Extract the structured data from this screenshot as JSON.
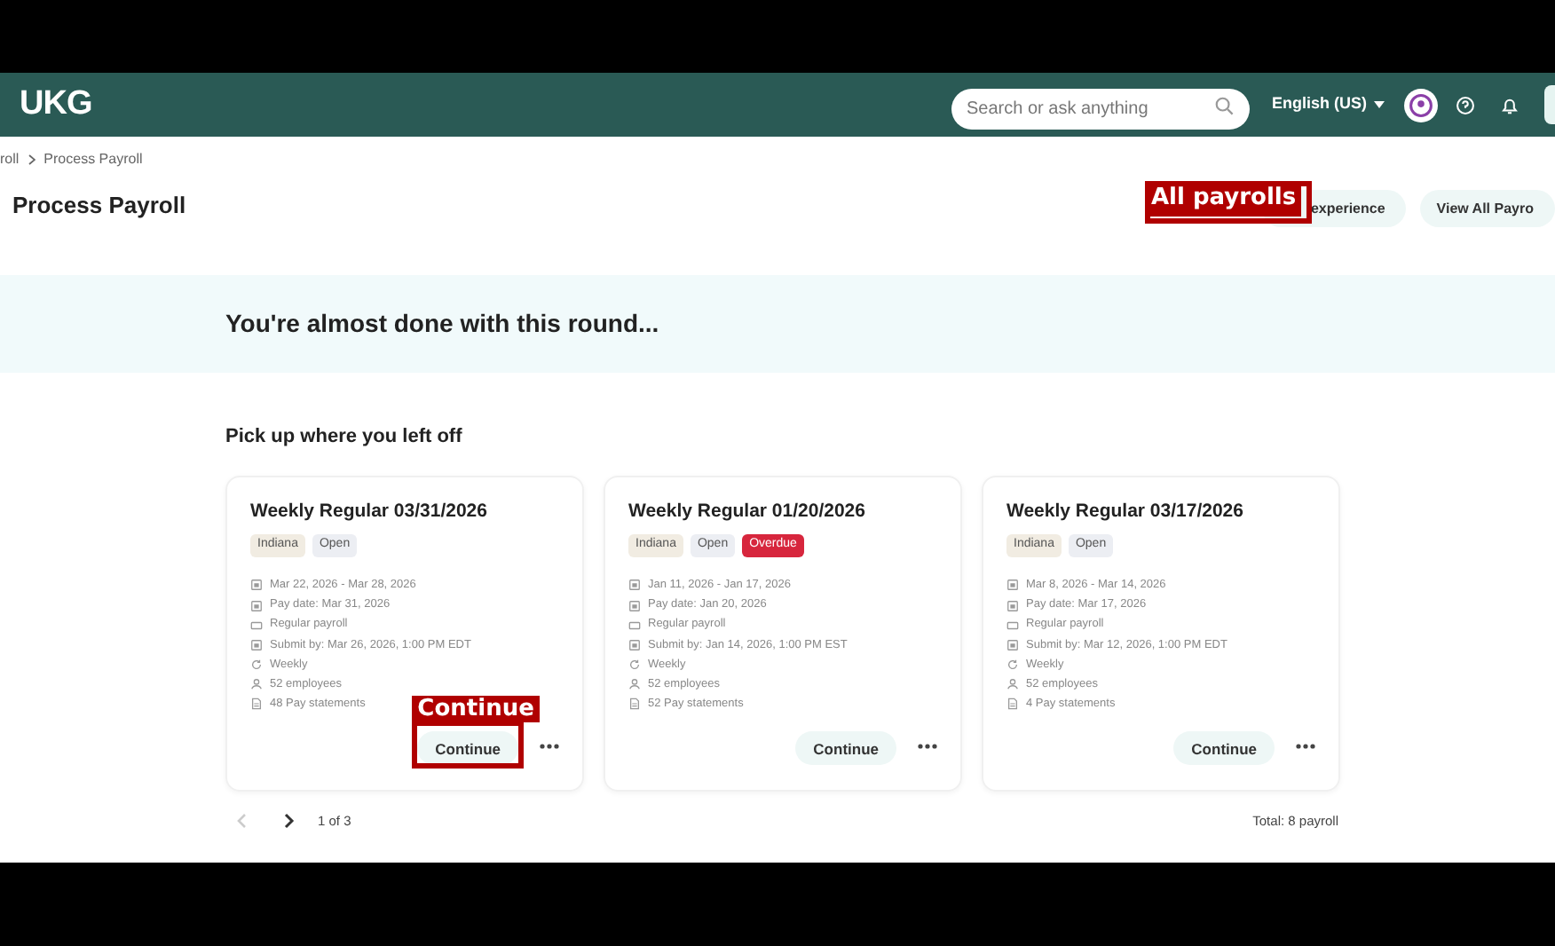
{
  "header": {
    "logo": "UKG",
    "search": {
      "placeholder": "Search or ask anything"
    },
    "language": "English (US)"
  },
  "breadcrumb": [
    "roll",
    "Process Payroll"
  ],
  "page_title": "Process Payroll",
  "header_buttons": [
    {
      "label": "experience",
      "annotation": "All payrolls"
    },
    {
      "label": "View All Payro"
    }
  ],
  "banner": "You're almost done with this round...",
  "section_title": "Pick up where you left off",
  "cards": [
    {
      "title": "Weekly Regular 03/31/2026",
      "tags": [
        {
          "label": "Indiana",
          "kind": "region"
        },
        {
          "label": "Open",
          "kind": "status"
        }
      ],
      "details": [
        {
          "kind": "calendar",
          "text": "Mar 22, 2026 - Mar 28, 2026"
        },
        {
          "kind": "calendar",
          "text": "Pay date: Mar 31, 2026"
        },
        {
          "kind": "card",
          "text": "Regular payroll"
        },
        {
          "kind": "calendar",
          "text": "Submit by: Mar 26, 2026, 1:00 PM EDT"
        },
        {
          "kind": "repeat",
          "text": "Weekly"
        },
        {
          "kind": "person",
          "text": "52 employees"
        },
        {
          "kind": "document",
          "text": "48 Pay statements"
        }
      ],
      "button": "Continue",
      "annotation": "Continue"
    },
    {
      "title": "Weekly Regular 01/20/2026",
      "tags": [
        {
          "label": "Indiana",
          "kind": "region"
        },
        {
          "label": "Open",
          "kind": "status"
        },
        {
          "label": "Overdue",
          "kind": "alert"
        }
      ],
      "details": [
        {
          "kind": "calendar",
          "text": "Jan 11, 2026 - Jan 17, 2026"
        },
        {
          "kind": "calendar",
          "text": "Pay date: Jan 20, 2026"
        },
        {
          "kind": "card",
          "text": "Regular payroll"
        },
        {
          "kind": "calendar",
          "text": "Submit by: Jan 14, 2026, 1:00 PM EST"
        },
        {
          "kind": "repeat",
          "text": "Weekly"
        },
        {
          "kind": "person",
          "text": "52 employees"
        },
        {
          "kind": "document",
          "text": "52 Pay statements"
        }
      ],
      "button": "Continue"
    },
    {
      "title": "Weekly Regular 03/17/2026",
      "tags": [
        {
          "label": "Indiana",
          "kind": "region"
        },
        {
          "label": "Open",
          "kind": "status"
        }
      ],
      "details": [
        {
          "kind": "calendar",
          "text": "Mar 8, 2026 - Mar 14, 2026"
        },
        {
          "kind": "calendar",
          "text": "Pay date: Mar 17, 2026"
        },
        {
          "kind": "card",
          "text": "Regular payroll"
        },
        {
          "kind": "calendar",
          "text": "Submit by: Mar 12, 2026, 1:00 PM EDT"
        },
        {
          "kind": "repeat",
          "text": "Weekly"
        },
        {
          "kind": "person",
          "text": "52 employees"
        },
        {
          "kind": "document",
          "text": "4 Pay statements"
        }
      ],
      "button": "Continue"
    }
  ],
  "pagination": {
    "page": "1 of 3",
    "total": "Total: 8 payroll"
  }
}
